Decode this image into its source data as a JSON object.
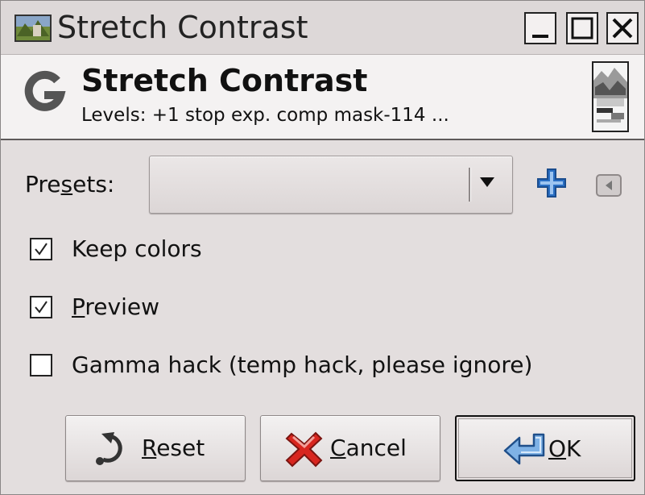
{
  "window": {
    "title": "Stretch Contrast",
    "controls": [
      "minimize-icon",
      "maximize-icon",
      "close-icon"
    ]
  },
  "header": {
    "title": "Stretch Contrast",
    "subtitle": "Levels: +1 stop exp. comp mask-114 ..."
  },
  "presets": {
    "label_before": "Pre",
    "label_mnemonic": "s",
    "label_after": "ets:",
    "value": "",
    "add_icon": "plus-icon",
    "menu_icon": "tab-menu-icon"
  },
  "options": [
    {
      "label_before": "",
      "label_mnemonic": "",
      "label_after": "Keep colors",
      "checked": true
    },
    {
      "label_before": "",
      "label_mnemonic": "P",
      "label_after": "review",
      "checked": true
    },
    {
      "label_before": "",
      "label_mnemonic": "",
      "label_after": "Gamma hack (temp hack, please ignore)",
      "checked": false
    }
  ],
  "buttons": {
    "reset": {
      "mnemonic": "R",
      "rest": "eset",
      "icon": "reset-icon"
    },
    "cancel": {
      "mnemonic": "C",
      "rest": "ancel",
      "icon": "cancel-icon"
    },
    "ok": {
      "mnemonic": "O",
      "rest": "K",
      "icon": "ok-icon"
    }
  },
  "colors": {
    "background": "#e3dede",
    "header_background": "#f4f2f2",
    "accent_blue": "#2a6fc4",
    "cancel_red": "#d8261f"
  }
}
